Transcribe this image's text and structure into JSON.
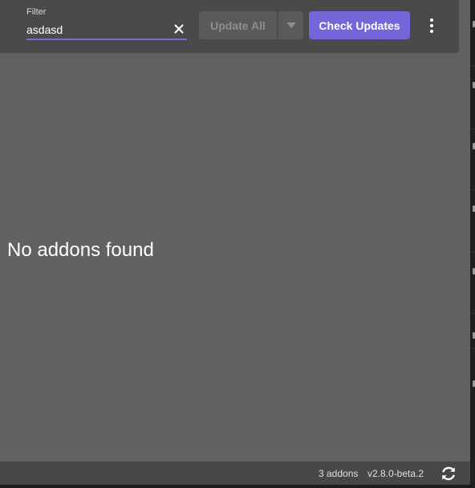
{
  "toolbar": {
    "filter_label": "Filter",
    "filter_value": "asdasd",
    "clear_icon": "close-icon",
    "update_all_label": "Update All",
    "update_all_enabled": false,
    "dropdown_icon": "caret-down-icon",
    "check_updates_label": "Check Updates",
    "more_icon": "more-vertical-icon"
  },
  "main": {
    "empty_message": "No addons found"
  },
  "status_bar": {
    "addon_count": "3 addons",
    "version": "v2.8.0-beta.2",
    "refresh_icon": "refresh-icon"
  },
  "colors": {
    "accent": "#7465d8",
    "content_bg": "#616161",
    "toolbar_bg": "#4a4a4a",
    "status_bg": "#474747"
  }
}
